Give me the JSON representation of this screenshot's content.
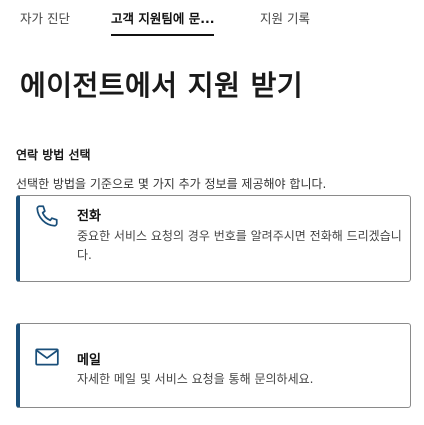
{
  "tabs": [
    {
      "label": "자가 진단"
    },
    {
      "label": "고객 지원팀에 문..."
    },
    {
      "label": "지원 기록"
    }
  ],
  "page_title": "에이전트에서 지원 받기",
  "section": {
    "label": "연락 방법 선택",
    "description": "선택한 방법을 기준으로 몇 가지 추가 정보를 제공해야 합니다."
  },
  "options": {
    "phone": {
      "icon": "phone-icon",
      "title": "전화",
      "description": "중요한 서비스 요청의 경우 번호를 알려주시면 전화해 드리겠습니다."
    },
    "mail": {
      "icon": "mail-icon",
      "title": "메일",
      "description": "자세한 메일 및 서비스 요청을 통해 문의하세요."
    }
  },
  "colors": {
    "accent": "#1a4f7a",
    "border": "#8a8a8a"
  }
}
